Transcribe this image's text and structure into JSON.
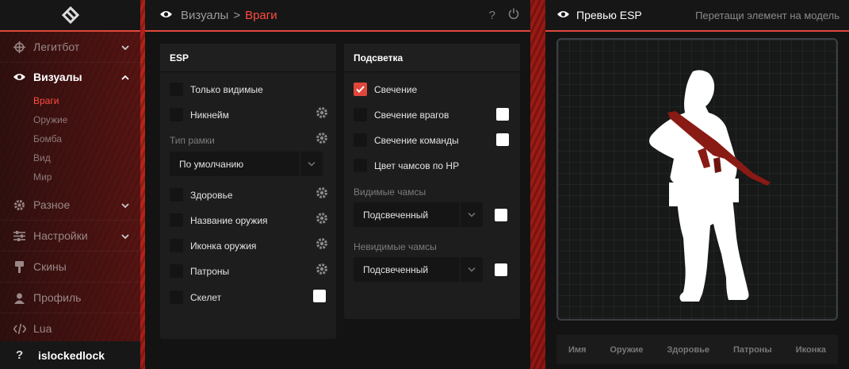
{
  "sidebar": {
    "items": [
      {
        "label": "Легитбот",
        "icon": "crosshair-icon",
        "expandable": true
      },
      {
        "label": "Визуалы",
        "icon": "eye-icon",
        "expandable": true,
        "active": true
      },
      {
        "label": "Разное",
        "icon": "gear-icon",
        "expandable": true
      },
      {
        "label": "Настройки",
        "icon": "sliders-icon",
        "expandable": true
      },
      {
        "label": "Скины",
        "icon": "brush-icon",
        "expandable": false
      },
      {
        "label": "Профиль",
        "icon": "profile-icon",
        "expandable": false
      },
      {
        "label": "Lua",
        "icon": "code-icon",
        "expandable": false
      }
    ],
    "subitems": [
      "Враги",
      "Оружие",
      "Бомба",
      "Вид",
      "Мир"
    ],
    "username": "islockedlock",
    "avatar_glyph": "?"
  },
  "header": {
    "root": "Визуалы",
    "separator": ">",
    "current": "Враги",
    "help_glyph": "?"
  },
  "esp": {
    "title": "ESP",
    "only_visible": "Только видимые",
    "nickname": "Никнейм",
    "box_type_label": "Тип рамки",
    "box_type_value": "По умолчанию",
    "health": "Здоровье",
    "weapon_name": "Название оружия",
    "weapon_icon": "Иконка оружия",
    "ammo": "Патроны",
    "skeleton": "Скелет"
  },
  "glow": {
    "title": "Подсветка",
    "glow": "Свечение",
    "glow_checked": true,
    "enemy_glow": "Свечение врагов",
    "team_glow": "Свечение команды",
    "chams_hp": "Цвет чамсов по HP",
    "visible_chams_label": "Видимые чамсы",
    "visible_chams_value": "Подсвеченный",
    "invisible_chams_label": "Невидимые чамсы",
    "invisible_chams_value": "Подсвеченный"
  },
  "preview": {
    "title": "Превью ESP",
    "hint": "Перетащи элемент на модель",
    "tabs": [
      "Имя",
      "Оружие",
      "Здоровье",
      "Патроны",
      "Иконка"
    ]
  },
  "colors": {
    "accent": "#e0473c",
    "active_sub": "#ff4b40",
    "panel": "#1d1d1d",
    "swatch": "#ffffff"
  }
}
